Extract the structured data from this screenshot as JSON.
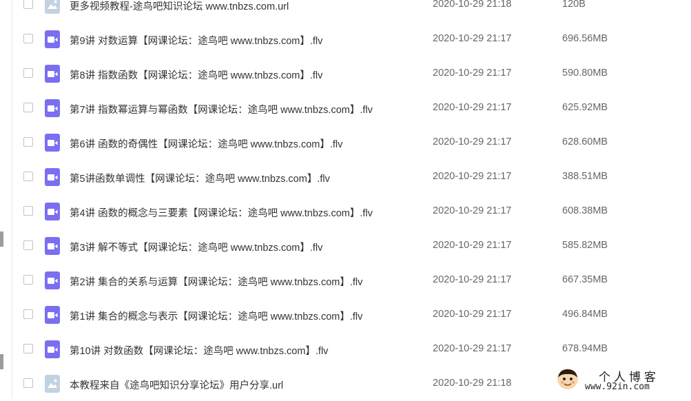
{
  "files": [
    {
      "icon": "url-file-icon",
      "name": "更多视频教程-途鸟吧知识论坛 www.tnbzs.com.url",
      "date": "2020-10-29 21:18",
      "size": "120B"
    },
    {
      "icon": "video-file-icon",
      "name": "第9讲 对数运算【网课论坛：途鸟吧 www.tnbzs.com】.flv",
      "date": "2020-10-29 21:17",
      "size": "696.56MB"
    },
    {
      "icon": "video-file-icon",
      "name": "第8讲 指数函数【网课论坛：途鸟吧 www.tnbzs.com】.flv",
      "date": "2020-10-29 21:17",
      "size": "590.80MB"
    },
    {
      "icon": "video-file-icon",
      "name": "第7讲 指数幂运算与幂函数【网课论坛：途鸟吧 www.tnbzs.com】.flv",
      "date": "2020-10-29 21:17",
      "size": "625.92MB"
    },
    {
      "icon": "video-file-icon",
      "name": "第6讲 函数的奇偶性【网课论坛：途鸟吧 www.tnbzs.com】.flv",
      "date": "2020-10-29 21:17",
      "size": "628.60MB"
    },
    {
      "icon": "video-file-icon",
      "name": "第5讲函数单调性【网课论坛：途鸟吧 www.tnbzs.com】.flv",
      "date": "2020-10-29 21:17",
      "size": "388.51MB"
    },
    {
      "icon": "video-file-icon",
      "name": "第4讲 函数的概念与三要素【网课论坛：途鸟吧 www.tnbzs.com】.flv",
      "date": "2020-10-29 21:17",
      "size": "608.38MB"
    },
    {
      "icon": "video-file-icon",
      "name": "第3讲 解不等式【网课论坛：途鸟吧 www.tnbzs.com】.flv",
      "date": "2020-10-29 21:17",
      "size": "585.82MB"
    },
    {
      "icon": "video-file-icon",
      "name": "第2讲 集合的关系与运算【网课论坛：途鸟吧 www.tnbzs.com】.flv",
      "date": "2020-10-29 21:17",
      "size": "667.35MB"
    },
    {
      "icon": "video-file-icon",
      "name": "第1讲 集合的概念与表示【网课论坛：途鸟吧 www.tnbzs.com】.flv",
      "date": "2020-10-29 21:17",
      "size": "496.84MB"
    },
    {
      "icon": "video-file-icon",
      "name": "第10讲 对数函数【网课论坛：途鸟吧 www.tnbzs.com】.flv",
      "date": "2020-10-29 21:17",
      "size": "678.94MB"
    },
    {
      "icon": "url-file-icon",
      "name": "本教程来自《途鸟吧知识分享论坛》用户分享.url",
      "date": "2020-10-29 21:18",
      "size": ""
    }
  ],
  "watermark": {
    "title": "个人博客",
    "url": "www.92in.com"
  },
  "colors": {
    "video_icon": "#7a6ff0",
    "url_icon": "#c3d2e2",
    "text": "#333333",
    "meta_text": "#666666"
  }
}
